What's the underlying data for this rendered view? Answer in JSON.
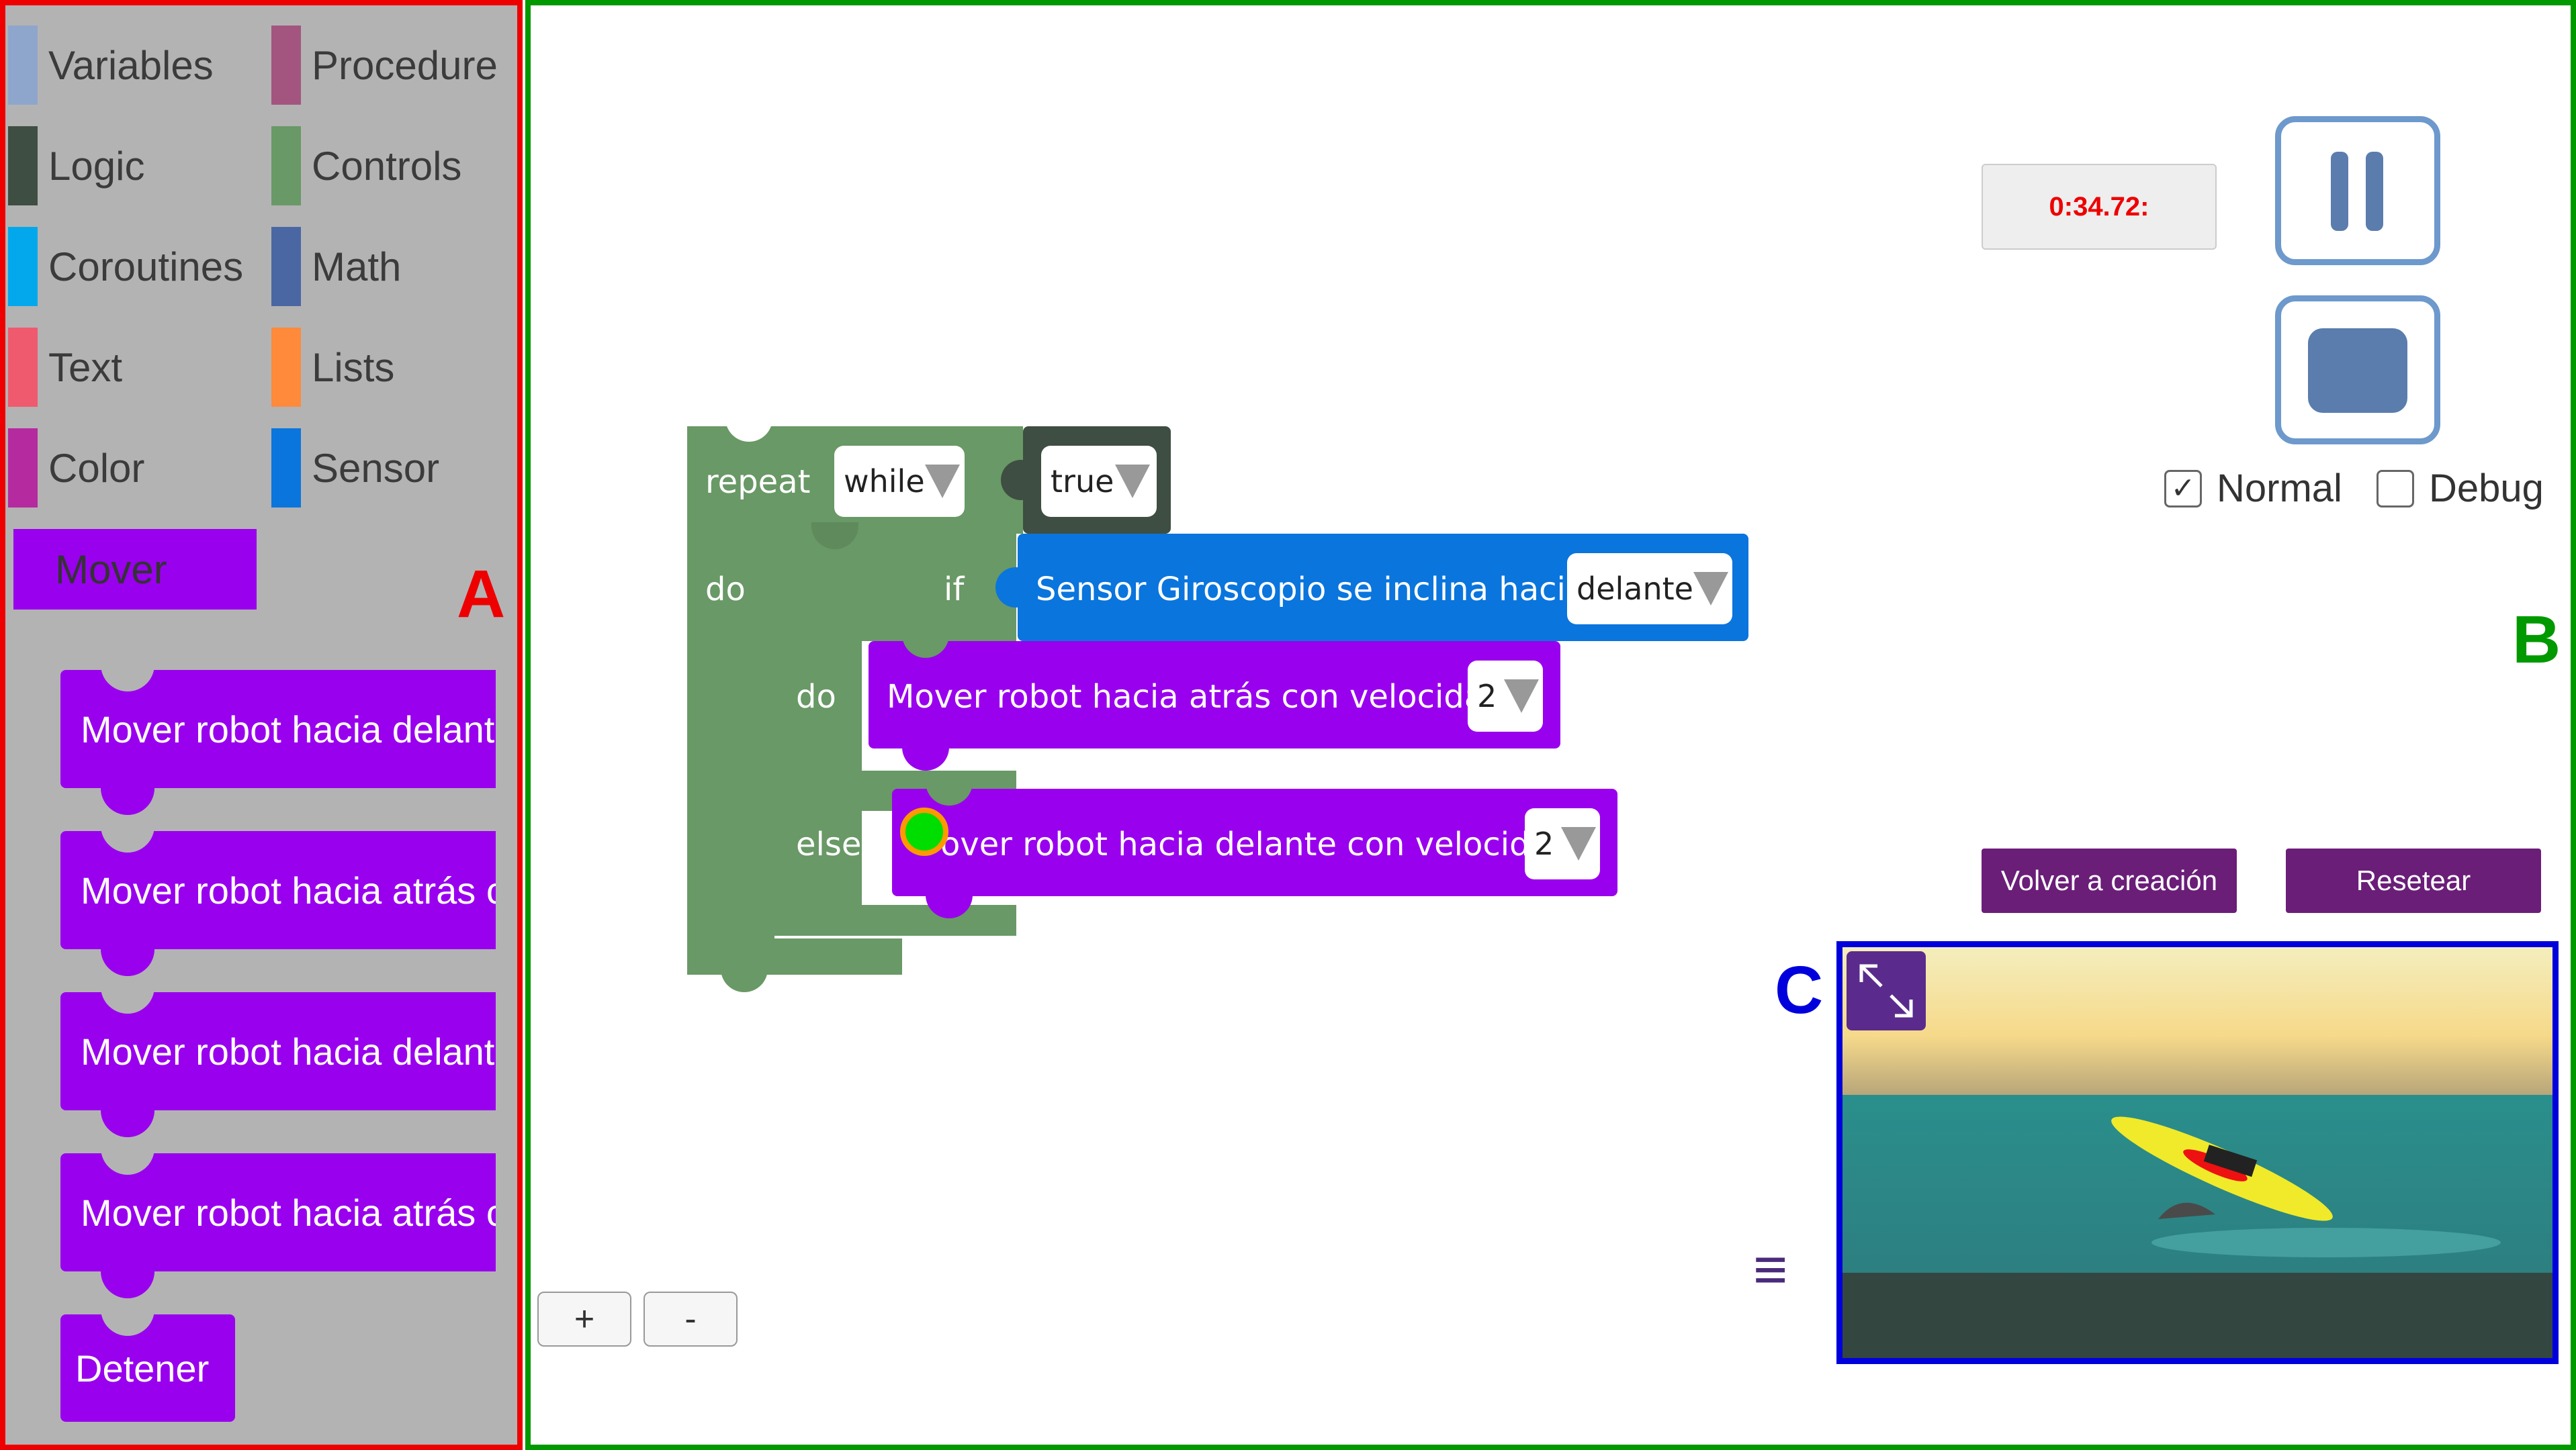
{
  "annotations": {
    "a": "A",
    "b": "B",
    "c": "C"
  },
  "colors": {
    "variables": "#8fa6cc",
    "procedure": "#a3557f",
    "logic": "#3e4e42",
    "controls": "#699966",
    "coroutines": "#03a8ec",
    "math": "#4a67a3",
    "text": "#f05a6e",
    "lists": "#ff8a3c",
    "color": "#b52a9e",
    "sensor": "#0a75dd",
    "mover": "#9900ee"
  },
  "toolbox": {
    "categories": [
      {
        "label": "Variables"
      },
      {
        "label": "Procedure"
      },
      {
        "label": "Logic"
      },
      {
        "label": "Controls"
      },
      {
        "label": "Coroutines"
      },
      {
        "label": "Math"
      },
      {
        "label": "Text"
      },
      {
        "label": "Lists"
      },
      {
        "label": "Color"
      },
      {
        "label": "Sensor"
      }
    ],
    "selected": "Mover",
    "flyout_blocks": [
      "Mover robot hacia delante",
      "Mover robot hacia atrás c",
      "Mover robot hacia delante",
      "Mover robot hacia atrás c",
      "Detener"
    ]
  },
  "workspace": {
    "repeat_label": "repeat",
    "repeat_mode": "while",
    "repeat_value": "true",
    "do_label": "do",
    "if_label": "if",
    "sensor_text": "Sensor Giroscopio se inclina hacia",
    "sensor_direction": "delante",
    "inner_do_label": "do",
    "else_label": "else",
    "move_back_text": "Mover robot hacia atrás con velocidad",
    "move_back_speed": "2",
    "move_fwd_text": "over robot hacia delante con velocidad",
    "move_fwd_speed": "2",
    "zoom_in": "+",
    "zoom_out": "-"
  },
  "controls": {
    "timer": "0:34.72:",
    "normal_label": "Normal",
    "normal_checked": true,
    "debug_label": "Debug",
    "debug_checked": false,
    "back_button": "Volver a creación",
    "reset_button": "Resetear",
    "menu_icon": "≡"
  }
}
